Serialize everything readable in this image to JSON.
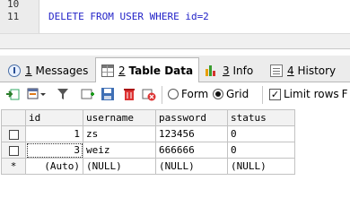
{
  "editor": {
    "lines": [
      {
        "number": "10",
        "code": ""
      },
      {
        "number": "11",
        "code": "DELETE FROM USER WHERE id=2"
      }
    ]
  },
  "tabs": [
    {
      "key": "1",
      "label": "Messages",
      "icon": "messages-icon",
      "active": false
    },
    {
      "key": "2",
      "label": "Table Data",
      "icon": "table-icon",
      "active": true
    },
    {
      "key": "3",
      "label": "Info",
      "icon": "info-icon",
      "active": false
    },
    {
      "key": "4",
      "label": "History",
      "icon": "history-icon",
      "active": false
    }
  ],
  "toolbar": {
    "view_mode_form_label": "Form",
    "view_mode_grid_label": "Grid",
    "view_mode_selected": "Grid",
    "limit_rows_label": "Limit rows",
    "limit_rows_suffix": "F",
    "limit_rows_checked": true
  },
  "grid": {
    "columns": [
      "id",
      "username",
      "password",
      "status"
    ],
    "rows": [
      {
        "id": "1",
        "username": "zs",
        "password": "123456",
        "status": "0"
      },
      {
        "id": "3",
        "username": "weiz",
        "password": "666666",
        "status": "0"
      }
    ],
    "new_row": {
      "marker": "*",
      "id": "(Auto)",
      "username": "(NULL)",
      "password": "(NULL)",
      "status": "(NULL)"
    }
  }
}
